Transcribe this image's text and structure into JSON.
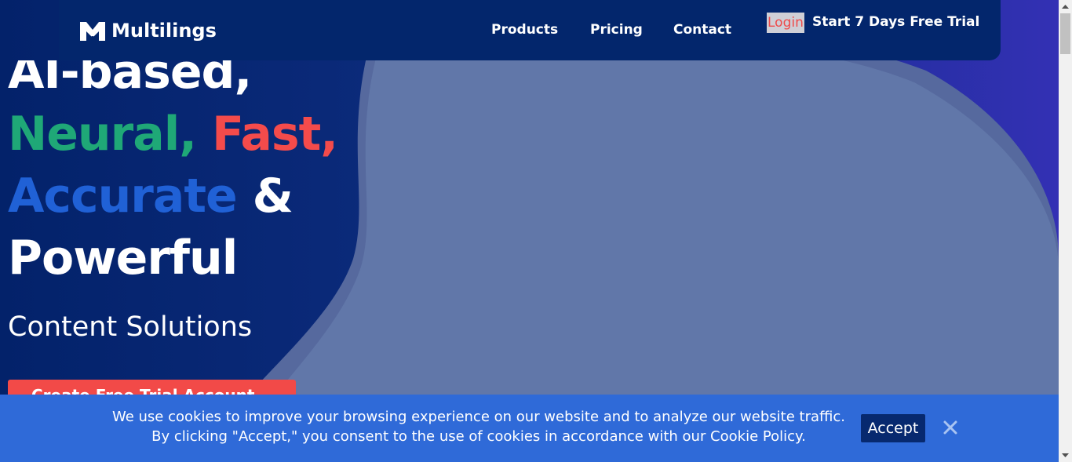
{
  "brand": {
    "name": "Multilings",
    "colors": {
      "navy": "#03266c",
      "green": "#1fa877",
      "red": "#f44b4b",
      "blue": "#2061d6",
      "banner": "#2f6ad8",
      "login_bg": "#cfcfd6"
    }
  },
  "nav": {
    "products": "Products",
    "pricing": "Pricing",
    "contact": "Contact",
    "login": "Login",
    "trial": "Start 7 Days Free Trial"
  },
  "hero": {
    "line1": "AI-based,",
    "line2_green": "Neural,",
    "line2_red": "Fast,",
    "line3_blue": "Accurate",
    "line3_white": "&",
    "line4": "Powerful",
    "subhead": "Content Solutions",
    "cta": "Create Free Trial Account"
  },
  "cookie": {
    "line1": "We use cookies to improve your browsing experience on our website and to analyze our website traffic.",
    "line2": "By clicking \"Accept,\" you consent to the use of cookies in accordance with our Cookie Policy.",
    "accept": "Accept",
    "close_icon": "close-icon"
  }
}
